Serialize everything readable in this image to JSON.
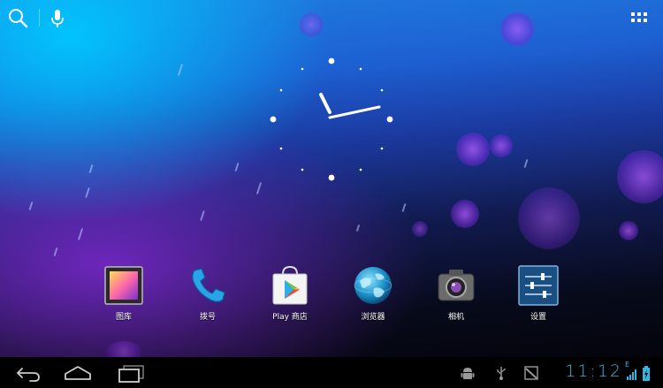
{
  "apps": [
    {
      "label": "图库",
      "icon": "gallery-icon"
    },
    {
      "label": "拨号",
      "icon": "phone-icon"
    },
    {
      "label": "Play 商店",
      "icon": "play-store-icon"
    },
    {
      "label": "浏览器",
      "icon": "browser-globe-icon"
    },
    {
      "label": "相机",
      "icon": "camera-icon"
    },
    {
      "label": "设置",
      "icon": "settings-icon"
    }
  ],
  "status_bar": {
    "time": "11:12",
    "network_type": "E"
  },
  "colors": {
    "accent": "#33b5e5",
    "nav_background": "#000000"
  },
  "top_bar": {
    "icons": [
      "search-icon",
      "microphone-icon",
      "all-apps-icon"
    ]
  },
  "nav_bar": {
    "icons": [
      "back-icon",
      "home-icon",
      "recent-apps-icon"
    ]
  }
}
